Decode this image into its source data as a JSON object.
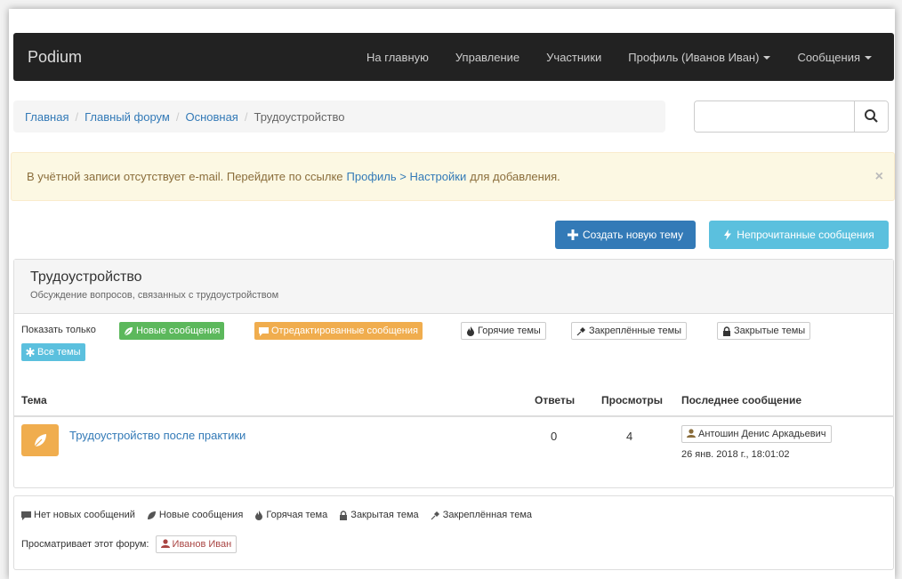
{
  "navbar": {
    "brand": "Podium",
    "links": [
      "На главную",
      "Управление",
      "Участники",
      "Профиль (Иванов Иван)",
      "Сообщения"
    ]
  },
  "breadcrumb": {
    "items": [
      "Главная",
      "Главный форум",
      "Основная"
    ],
    "active": "Трудоустройство"
  },
  "search": {
    "value": "",
    "placeholder": ""
  },
  "alert": {
    "text_before": "В учётной записи отсутствует e-mail. Перейдите по ссылке",
    "link": "Профиль > Настройки",
    "text_after": "для добавления.",
    "close": "×"
  },
  "actions": {
    "create": "Создать новую тему",
    "unread": "Непрочитанные сообщения"
  },
  "forum": {
    "title": "Трудоустройство",
    "subtitle": "Обсуждение вопросов, связанных с трудоустройством"
  },
  "filters": {
    "label": "Показать только",
    "new": "Новые сообщения",
    "edited": "Отредактированные сообщения",
    "hot": "Горячие темы",
    "pinned": "Закреплённые темы",
    "closed": "Закрытые темы",
    "all": "Все темы"
  },
  "table": {
    "headers": {
      "topic": "Тема",
      "replies": "Ответы",
      "views": "Просмотры",
      "last": "Последнее сообщение"
    },
    "rows": [
      {
        "title": "Трудоустройство после практики",
        "replies": "0",
        "views": "4",
        "last_user": "Антошин Денис Аркадьевич",
        "last_date": "26 янв. 2018 г., 18:01:02"
      }
    ]
  },
  "legend": {
    "no_new": "Нет новых сообщений",
    "new": "Новые сообщения",
    "hot": "Горячая тема",
    "closed": "Закрытая тема",
    "pinned": "Закреплённая тема"
  },
  "viewers": {
    "label": "Просматривает этот форум:",
    "user": "Иванов Иван"
  },
  "colors": {
    "navbar": "#222222",
    "primary": "#337ab7",
    "info": "#5bc0de",
    "success": "#5cb85c",
    "warning": "#f0ad4e",
    "alert_bg": "#fcf8e3"
  }
}
